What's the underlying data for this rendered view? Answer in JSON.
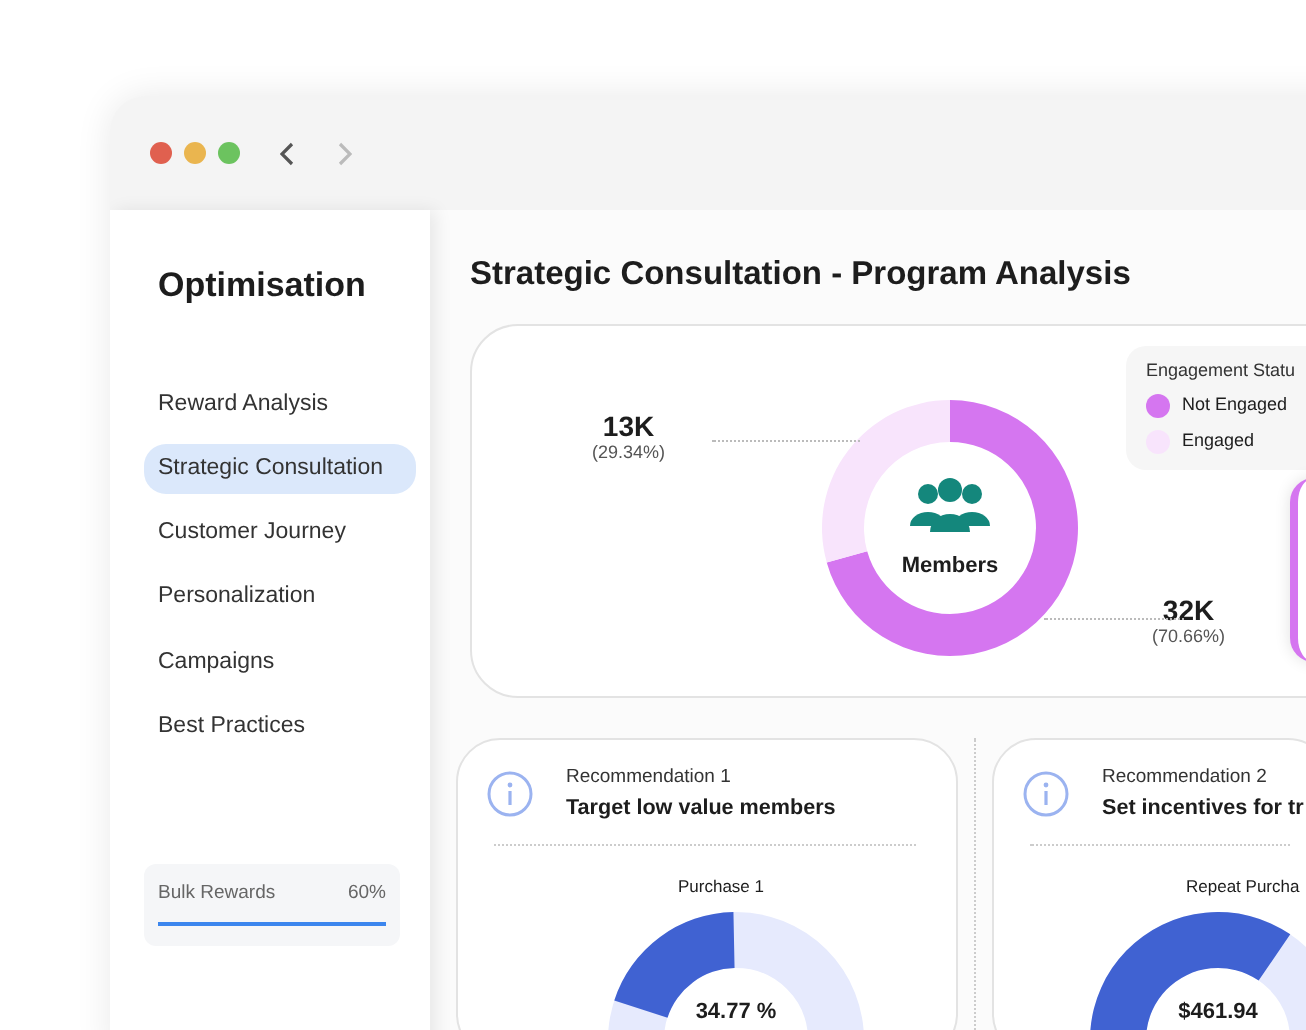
{
  "window": {
    "traffic_lights": [
      {
        "color": "#e0604f"
      },
      {
        "color": "#eab54f"
      },
      {
        "color": "#6cc35f"
      }
    ]
  },
  "sidebar": {
    "title": "Optimisation",
    "items": [
      {
        "label": "Reward Analysis",
        "selected": false
      },
      {
        "label": "Strategic Consultation",
        "selected": true
      },
      {
        "label": "Customer Journey",
        "selected": false
      },
      {
        "label": "Personalization",
        "selected": false
      },
      {
        "label": "Campaigns",
        "selected": false
      },
      {
        "label": "Best Practices",
        "selected": false
      }
    ],
    "progress": {
      "label": "Bulk Rewards",
      "reading": "60%",
      "level": 1
    }
  },
  "main": {
    "title": "Strategic Consultation - Program Analysis",
    "members_card": {
      "center_label": "Members",
      "chart_data": {
        "type": "donut",
        "categories": [
          "Not Engaged",
          "Engaged"
        ],
        "values": [
          70.66,
          29.34
        ]
      },
      "callouts": [
        {
          "value": "13K",
          "percent": "(29.34%)"
        },
        {
          "value": "32K",
          "percent": "(70.66%)"
        }
      ],
      "legend": {
        "title": "Engagement Statu",
        "items": [
          {
            "color": "#d576f0"
          },
          {
            "color": "#f8e4fc"
          }
        ]
      }
    },
    "recommendations": [
      {
        "heading": "Recommendation 1",
        "title": "Target low value members",
        "chart_title": "Purchase 1",
        "center_value": "34.77 %"
      },
      {
        "heading": "Recommendation 2",
        "title": "Set incentives for tr",
        "chart_title": "Repeat Purcha",
        "center_value": "$461.94"
      }
    ]
  }
}
